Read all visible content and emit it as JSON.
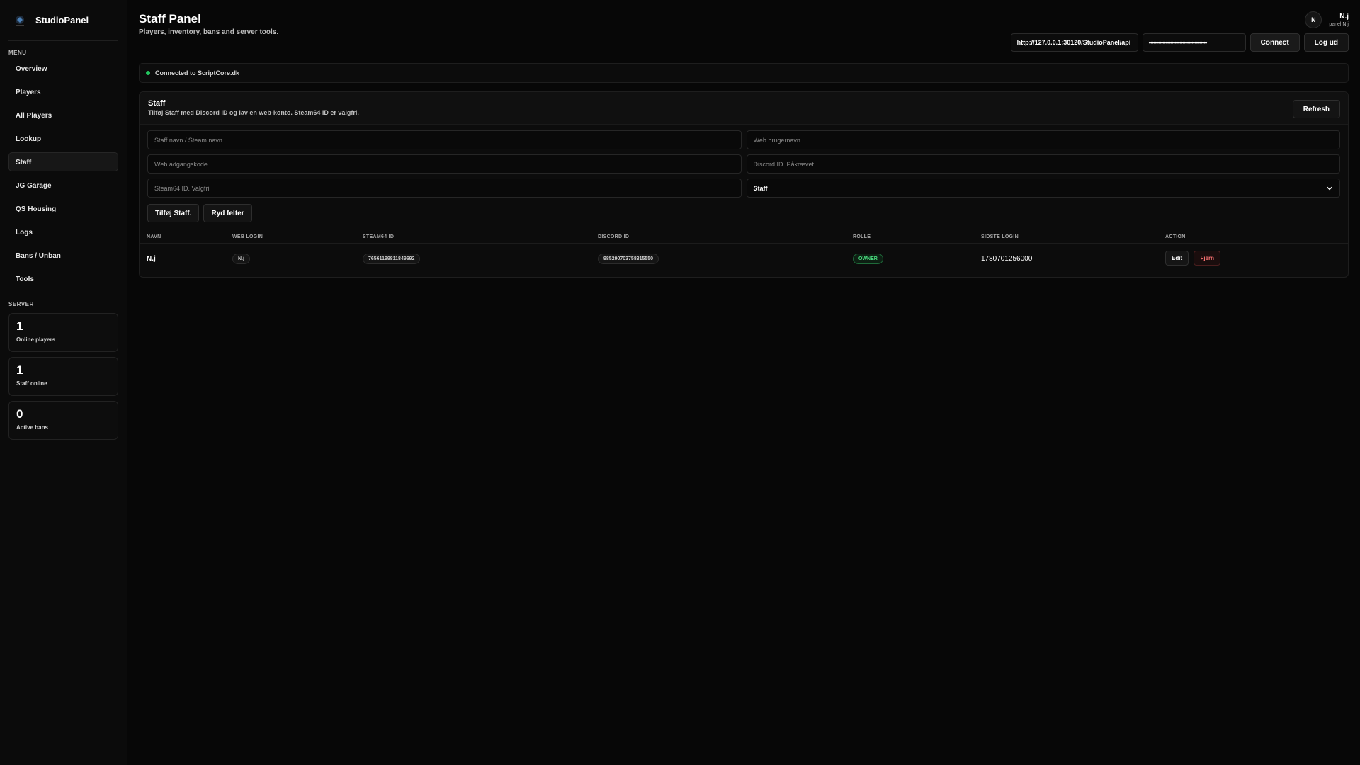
{
  "sidebar": {
    "brand": "StudioPanel",
    "menu_title": "MENU",
    "items": [
      {
        "label": "Overview"
      },
      {
        "label": "Players"
      },
      {
        "label": "All Players"
      },
      {
        "label": "Lookup"
      },
      {
        "label": "Staff"
      },
      {
        "label": "JG Garage"
      },
      {
        "label": "QS Housing"
      },
      {
        "label": "Logs"
      },
      {
        "label": "Bans / Unban"
      },
      {
        "label": "Tools"
      }
    ],
    "server_title": "SERVER",
    "stats": [
      {
        "value": "1",
        "label": "Online players"
      },
      {
        "value": "1",
        "label": "Staff online"
      },
      {
        "value": "0",
        "label": "Active bans"
      }
    ]
  },
  "header": {
    "title": "Staff Panel",
    "subtitle": "Players, inventory, bans and server tools.",
    "user": {
      "initial": "N",
      "name": "N.j",
      "sub": "panel:N.j"
    },
    "api_url": "http://127.0.0.1:30120/StudioPanel/api",
    "api_key_masked": "••••••••••••••••••••••••••••••••••••••",
    "connect_label": "Connect",
    "logout_label": "Log ud"
  },
  "status": {
    "text": "Connected to ScriptCore.dk",
    "color": "#22c55e"
  },
  "staff_panel": {
    "title": "Staff",
    "description": "Tilføj Staff med Discord ID og lav en web-konto. Steam64 ID er valgfri.",
    "refresh_label": "Refresh",
    "form": {
      "name_placeholder": "Staff navn / Steam navn.",
      "web_user_placeholder": "Web brugernavn.",
      "web_pass_placeholder": "Web adgangskode.",
      "discord_placeholder": "Discord ID. Påkrævet",
      "steam_placeholder": "Steam64 ID. Valgfri",
      "role_selected": "Staff"
    },
    "add_label": "Tilføj Staff.",
    "clear_label": "Ryd felter",
    "table": {
      "headers": [
        "NAVN",
        "WEB LOGIN",
        "STEAM64 ID",
        "DISCORD ID",
        "ROLLE",
        "SIDSTE LOGIN",
        "ACTION"
      ],
      "rows": [
        {
          "name": "N.j",
          "web_login": "N.j",
          "steam64": "76561199811849692",
          "discord": "985290703758315550",
          "role": "OWNER",
          "last_login": "1780701256000",
          "edit_label": "Edit",
          "remove_label": "Fjern"
        }
      ]
    }
  }
}
